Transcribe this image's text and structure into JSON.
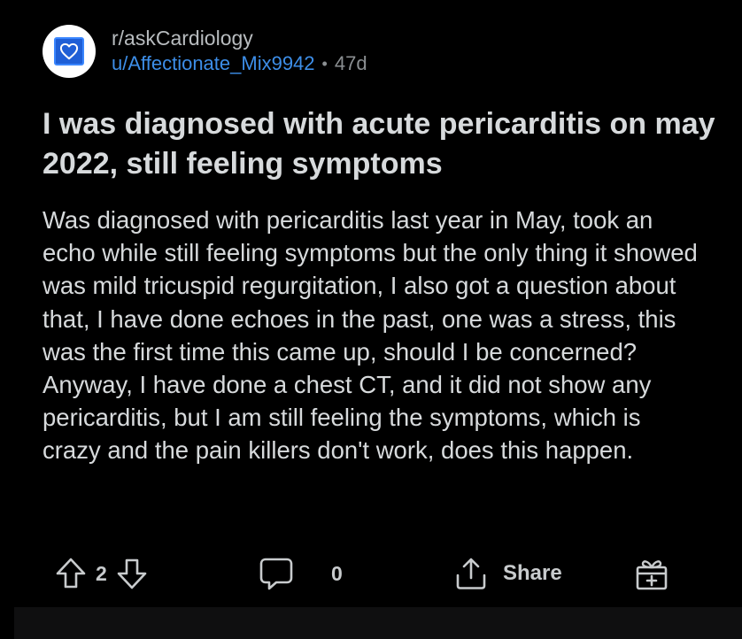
{
  "post": {
    "subreddit": "r/askCardiology",
    "author": "u/Affectionate_Mix9942",
    "separator": "•",
    "age": "47d",
    "title": "I was diagnosed with acute pericarditis on may 2022, still feeling symptoms",
    "body": "Was diagnosed with pericarditis last year in May, took an echo while still feeling symptoms but the only thing it showed was mild tricuspid regurgitation, I also got a question about that, I have done echoes in the past, one was a stress, this was the first time this came up, should I be concerned? Anyway, I have done a chest CT, and it did not show any pericarditis, but I am still feeling the symptoms, which is crazy and the pain killers don't work, does this happen."
  },
  "actions": {
    "vote_count": "2",
    "comment_count": "0",
    "share_label": "Share"
  },
  "icons": {
    "avatar": "heart-icon",
    "upvote": "arrow-up-icon",
    "downvote": "arrow-down-icon",
    "comment": "comment-bubble-icon",
    "share": "share-icon",
    "award": "gift-award-icon"
  },
  "colors": {
    "background": "#000000",
    "text": "#d7dadc",
    "username": "#3d8ee8",
    "avatar_bg": "#1f5fd6"
  }
}
